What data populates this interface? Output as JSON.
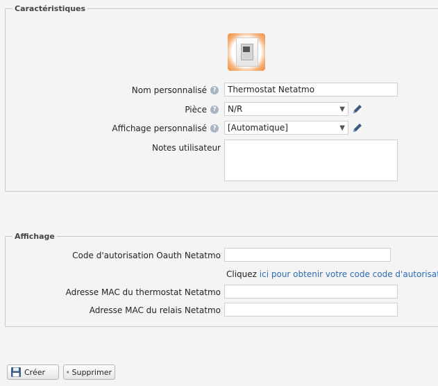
{
  "characteristics": {
    "legend": "Caractéristiques",
    "device_icon": "thermostat-device-image",
    "fields": {
      "custom_name_label": "Nom personnalisé",
      "custom_name_value": "Thermostat Netatmo",
      "room_label": "Pièce",
      "room_value": "N/R",
      "display_label": "Affichage personnalisé",
      "display_value": "[Automatique]",
      "notes_label": "Notes utilisateur",
      "notes_value": ""
    }
  },
  "display_section": {
    "legend": "Affichage",
    "oauth_label": "Code d'autorisation Oauth Netatmo",
    "oauth_value": "",
    "hint_prefix": "Cliquez",
    "hint_link": "ici pour obtenir votre code code d'autorisation",
    "mac_thermostat_label": "Adresse MAC du thermostat Netatmo",
    "mac_thermostat_value": "",
    "mac_relay_label": "Adresse MAC du relais Netatmo",
    "mac_relay_value": ""
  },
  "actions": {
    "create_label": "Créer",
    "delete_label": "Supprimer"
  },
  "icons": {
    "help": "help-circle-icon",
    "edit": "pencil-icon",
    "save": "floppy-disk-icon",
    "delete": "minus-circle-icon",
    "dropdown": "chevron-down-icon"
  },
  "colors": {
    "link": "#2a6cb4",
    "device_glow": "#f08c3c"
  }
}
